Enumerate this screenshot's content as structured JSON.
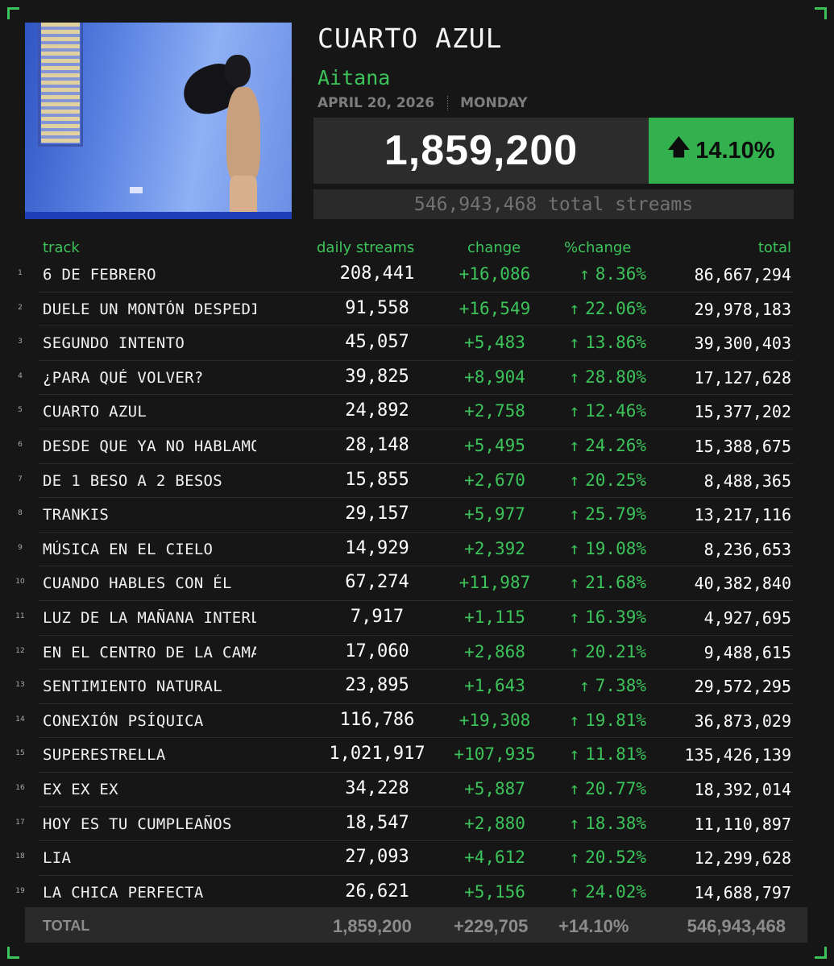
{
  "album": {
    "title": "CUARTO AZUL",
    "artist": "Aitana",
    "date": "APRIL 20, 2026",
    "weekday": "MONDAY",
    "daily_streams": "1,859,200",
    "percent_change": "14.10%",
    "total_streams_text": "546,943,468 total streams"
  },
  "columns": {
    "track": "track",
    "daily": "daily streams",
    "change": "change",
    "percent_change": "%change",
    "total": "total"
  },
  "tracks": [
    {
      "num": "1",
      "name": "6 DE FEBRERO",
      "daily": "208,441",
      "change": "+16,086",
      "pct": "8.36%",
      "total": "86,667,294"
    },
    {
      "num": "2",
      "name": "DUELE UN MONTÓN DESPEDIRNOS",
      "daily": "91,558",
      "change": "+16,549",
      "pct": "22.06%",
      "total": "29,978,183"
    },
    {
      "num": "3",
      "name": "SEGUNDO INTENTO",
      "daily": "45,057",
      "change": "+5,483",
      "pct": "13.86%",
      "total": "39,300,403"
    },
    {
      "num": "4",
      "name": "¿PARA QUÉ VOLVER?",
      "daily": "39,825",
      "change": "+8,904",
      "pct": "28.80%",
      "total": "17,127,628"
    },
    {
      "num": "5",
      "name": "CUARTO AZUL",
      "daily": "24,892",
      "change": "+2,758",
      "pct": "12.46%",
      "total": "15,377,202"
    },
    {
      "num": "6",
      "name": "DESDE QUE YA NO HABLAMOS",
      "daily": "28,148",
      "change": "+5,495",
      "pct": "24.26%",
      "total": "15,388,675"
    },
    {
      "num": "7",
      "name": "DE 1 BESO A 2 BESOS",
      "daily": "15,855",
      "change": "+2,670",
      "pct": "20.25%",
      "total": "8,488,365"
    },
    {
      "num": "8",
      "name": "TRANKIS",
      "daily": "29,157",
      "change": "+5,977",
      "pct": "25.79%",
      "total": "13,217,116"
    },
    {
      "num": "9",
      "name": "MÚSICA EN EL CIELO",
      "daily": "14,929",
      "change": "+2,392",
      "pct": "19.08%",
      "total": "8,236,653"
    },
    {
      "num": "10",
      "name": "CUANDO HABLES CON ÉL",
      "daily": "67,274",
      "change": "+11,987",
      "pct": "21.68%",
      "total": "40,382,840"
    },
    {
      "num": "11",
      "name": "LUZ DE LA MAÑANA INTERLUDIO",
      "daily": "7,917",
      "change": "+1,115",
      "pct": "16.39%",
      "total": "4,927,695"
    },
    {
      "num": "12",
      "name": "EN EL CENTRO DE LA CAMA",
      "daily": "17,060",
      "change": "+2,868",
      "pct": "20.21%",
      "total": "9,488,615"
    },
    {
      "num": "13",
      "name": "SENTIMIENTO NATURAL",
      "daily": "23,895",
      "change": "+1,643",
      "pct": "7.38%",
      "total": "29,572,295"
    },
    {
      "num": "14",
      "name": "CONEXIÓN PSÍQUICA",
      "daily": "116,786",
      "change": "+19,308",
      "pct": "19.81%",
      "total": "36,873,029"
    },
    {
      "num": "15",
      "name": "SUPERESTRELLA",
      "daily": "1,021,917",
      "change": "+107,935",
      "pct": "11.81%",
      "total": "135,426,139"
    },
    {
      "num": "16",
      "name": "EX EX EX",
      "daily": "34,228",
      "change": "+5,887",
      "pct": "20.77%",
      "total": "18,392,014"
    },
    {
      "num": "17",
      "name": "HOY ES TU CUMPLEAÑOS",
      "daily": "18,547",
      "change": "+2,880",
      "pct": "18.38%",
      "total": "11,110,897"
    },
    {
      "num": "18",
      "name": "LIA",
      "daily": "27,093",
      "change": "+4,612",
      "pct": "20.52%",
      "total": "12,299,628"
    },
    {
      "num": "19",
      "name": "LA CHICA PERFECTA",
      "daily": "26,621",
      "change": "+5,156",
      "pct": "24.02%",
      "total": "14,688,797"
    }
  ],
  "footer": {
    "label": "TOTAL",
    "daily": "1,859,200",
    "change": "+229,705",
    "pct": "+14.10%",
    "total": "546,943,468"
  },
  "colors": {
    "accent_green": "#3cc35a",
    "background": "#161616"
  },
  "icons": {
    "up_arrow": "↑",
    "big_up_arrow": "🡅"
  }
}
